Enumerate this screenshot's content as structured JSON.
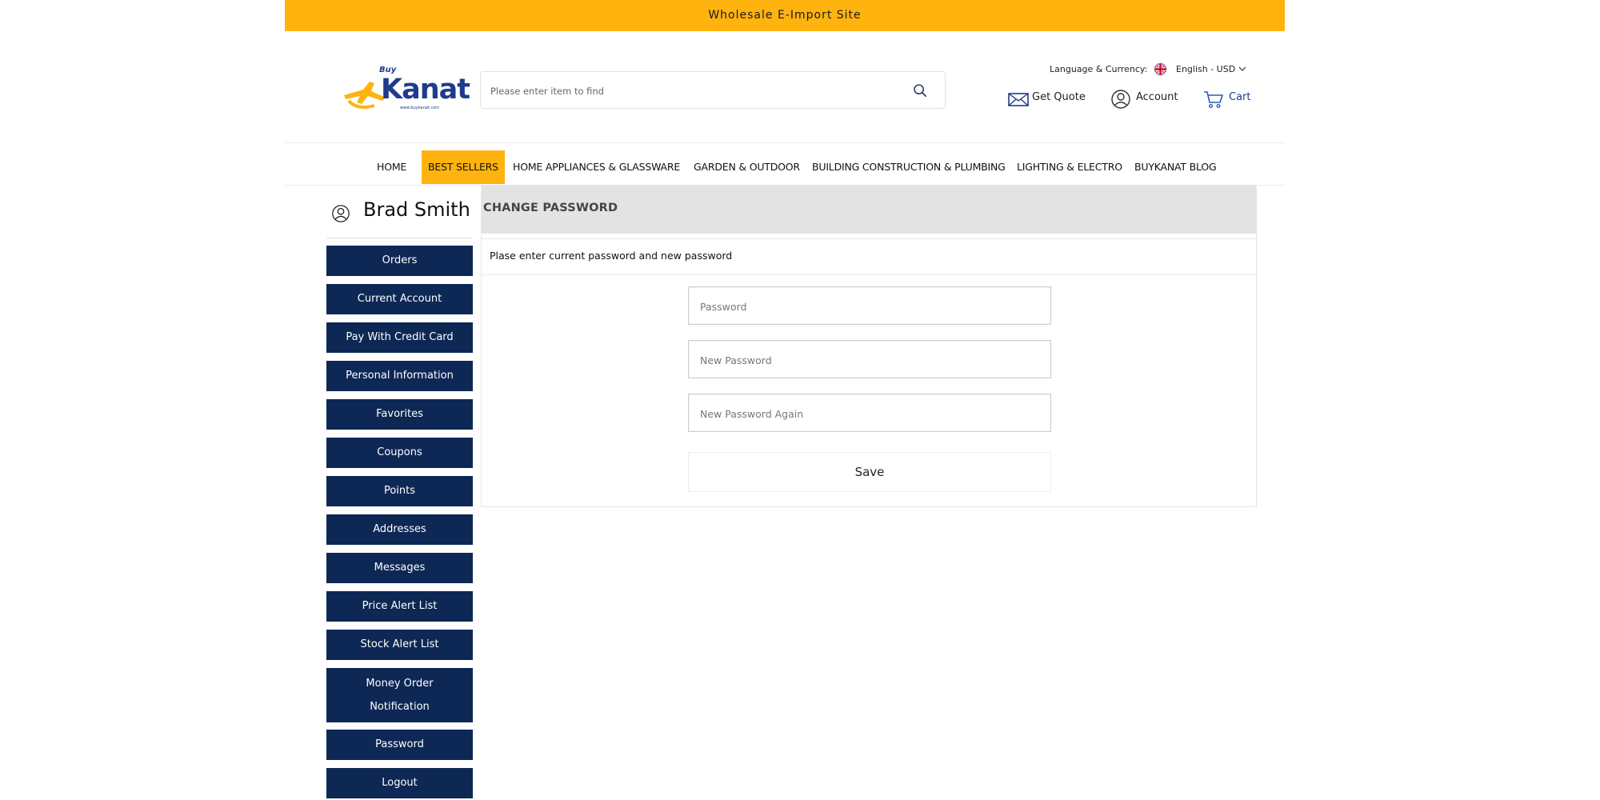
{
  "top_banner": {
    "text": "Wholesale E-Import Site"
  },
  "header": {
    "logo_text": "Kanat",
    "logo_script": "Buy",
    "logo_url_text": "www.buykanat.com",
    "search": {
      "placeholder": "Please enter item to find"
    },
    "language_currency": {
      "label": "Language & Currency:",
      "value": "English - USD"
    },
    "get_quote": "Get Quote",
    "account": "Account",
    "cart": "Cart",
    "colors": {
      "accent": "#ffb30f",
      "navy": "#0d2855",
      "cart_text": "#1f3b8a"
    }
  },
  "nav": {
    "items": [
      {
        "label": "HOME"
      },
      {
        "label": "BEST SELLERS",
        "active": true
      },
      {
        "label": "HOME APPLIANCES & GLASSWARE"
      },
      {
        "label": "GARDEN & OUTDOOR"
      },
      {
        "label": "BUILDING CONSTRUCTION & PLUMBING"
      },
      {
        "label": "LIGHTING & ELECTRO"
      },
      {
        "label": "BUYKANAT BLOG"
      }
    ]
  },
  "sidebar": {
    "user_name": "Brad Smith",
    "items": [
      {
        "label": "Orders"
      },
      {
        "label": "Current Account"
      },
      {
        "label": "Pay With Credit Card"
      },
      {
        "label": "Personal Information"
      },
      {
        "label": "Favorites"
      },
      {
        "label": "Coupons"
      },
      {
        "label": "Points"
      },
      {
        "label": "Addresses"
      },
      {
        "label": "Messages"
      },
      {
        "label": "Price Alert List"
      },
      {
        "label": "Stock Alert List"
      },
      {
        "label_line1": "Money Order",
        "label_line2": "Notification"
      },
      {
        "label": "Password"
      },
      {
        "label": "Logout"
      }
    ]
  },
  "main": {
    "title": "CHANGE PASSWORD",
    "instruction": "Plase enter current password and new password",
    "fields": {
      "current_password": {
        "placeholder": "Password",
        "value": ""
      },
      "new_password": {
        "placeholder": "New Password",
        "value": ""
      },
      "new_password_again": {
        "placeholder": "New Password Again",
        "value": ""
      }
    },
    "save_label": "Save"
  }
}
